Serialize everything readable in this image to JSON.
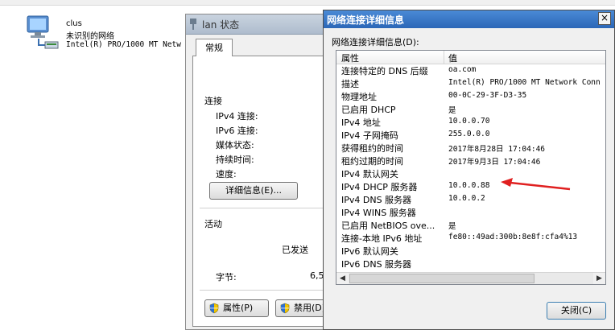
{
  "network_item": {
    "name": "clus",
    "status": "未识别的网络",
    "adapter": "Intel(R) PRO/1000 MT Netw"
  },
  "status_window": {
    "title": "lan 状态",
    "tab_general": "常规",
    "group_connection": "连接",
    "ipv4_label": "IPv4 连接:",
    "ipv6_label": "IPv6 连接:",
    "media_label": "媒体状态:",
    "duration_label": "持续时间:",
    "speed_label": "速度:",
    "details_button": "详细信息(E)...",
    "group_activity": "活动",
    "sent_label": "已发送",
    "bytes_label": "字节:",
    "bytes_value": "6,5",
    "properties_button": "属性(P)",
    "disable_button": "禁用(D)"
  },
  "details_dialog": {
    "title": "网络连接详细信息",
    "close_glyph": "×",
    "caption": "网络连接详细信息(D):",
    "col_property": "属性",
    "col_value": "值",
    "rows": [
      {
        "prop": "连接特定的 DNS 后缀",
        "val": "oa.com"
      },
      {
        "prop": "描述",
        "val": "Intel(R) PRO/1000 MT Network Conn"
      },
      {
        "prop": "物理地址",
        "val": "00-0C-29-3F-D3-35"
      },
      {
        "prop": "已启用 DHCP",
        "val": "是"
      },
      {
        "prop": "IPv4 地址",
        "val": "10.0.0.70"
      },
      {
        "prop": "IPv4 子网掩码",
        "val": "255.0.0.0"
      },
      {
        "prop": "获得租约的时间",
        "val": "2017年8月28日 17:04:46"
      },
      {
        "prop": "租约过期的时间",
        "val": "2017年9月3日 17:04:46"
      },
      {
        "prop": "IPv4 默认网关",
        "val": ""
      },
      {
        "prop": "IPv4 DHCP 服务器",
        "val": "10.0.0.88"
      },
      {
        "prop": "IPv4 DNS 服务器",
        "val": "10.0.0.2"
      },
      {
        "prop": "IPv4 WINS 服务器",
        "val": ""
      },
      {
        "prop": "已启用 NetBIOS ove...",
        "val": "是"
      },
      {
        "prop": "连接-本地 IPv6 地址",
        "val": "fe80::49ad:300b:8e8f:cfa4%13"
      },
      {
        "prop": "IPv6 默认网关",
        "val": ""
      },
      {
        "prop": "IPv6 DNS 服务器",
        "val": ""
      }
    ],
    "close_button": "关闭(C)"
  },
  "colors": {
    "title_active": "#2b67b7",
    "annotation_arrow": "#e02020"
  }
}
